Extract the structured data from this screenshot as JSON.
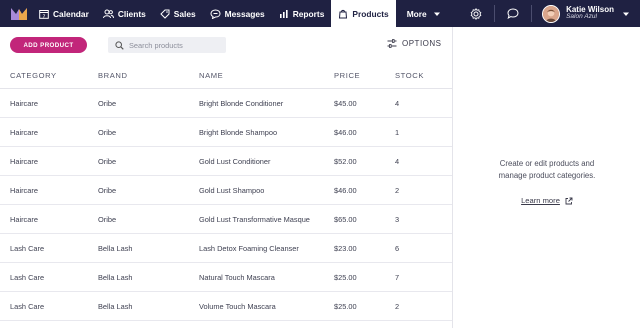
{
  "nav": {
    "items": [
      {
        "label": "Calendar",
        "icon": "calendar-icon"
      },
      {
        "label": "Clients",
        "icon": "clients-icon"
      },
      {
        "label": "Sales",
        "icon": "tag-icon"
      },
      {
        "label": "Messages",
        "icon": "messages-icon"
      },
      {
        "label": "Reports",
        "icon": "reports-icon"
      },
      {
        "label": "Products",
        "icon": "products-icon",
        "active": true
      },
      {
        "label": "More",
        "icon": "chevron-down-icon"
      }
    ],
    "user": {
      "name": "Katie Wilson",
      "salon": "Salon Azul"
    }
  },
  "toolbar": {
    "add_label": "ADD PRODUCT",
    "search_placeholder": "Search products",
    "options_label": "OPTIONS"
  },
  "table": {
    "headers": {
      "category": "CATEGORY",
      "brand": "BRAND",
      "name": "NAME",
      "price": "PRICE",
      "stock": "STOCK"
    },
    "rows": [
      {
        "category": "Haircare",
        "brand": "Oribe",
        "name": "Bright Blonde Conditioner",
        "price": "$45.00",
        "stock": "4"
      },
      {
        "category": "Haircare",
        "brand": "Oribe",
        "name": "Bright Blonde Shampoo",
        "price": "$46.00",
        "stock": "1"
      },
      {
        "category": "Haircare",
        "brand": "Oribe",
        "name": "Gold Lust Conditioner",
        "price": "$52.00",
        "stock": "4"
      },
      {
        "category": "Haircare",
        "brand": "Oribe",
        "name": "Gold Lust Shampoo",
        "price": "$46.00",
        "stock": "2"
      },
      {
        "category": "Haircare",
        "brand": "Oribe",
        "name": "Gold Lust Transformative Masque",
        "price": "$65.00",
        "stock": "3"
      },
      {
        "category": "Lash Care",
        "brand": "Bella Lash",
        "name": "Lash Detox Foaming Cleanser",
        "price": "$23.00",
        "stock": "6"
      },
      {
        "category": "Lash Care",
        "brand": "Bella Lash",
        "name": "Natural Touch Mascara",
        "price": "$25.00",
        "stock": "7"
      },
      {
        "category": "Lash Care",
        "brand": "Bella Lash",
        "name": "Volume Touch Mascara",
        "price": "$25.00",
        "stock": "2"
      }
    ]
  },
  "side": {
    "line1": "Create or edit products and",
    "line2": "manage product categories.",
    "link_label": "Learn more"
  },
  "colors": {
    "nav_bg": "#1f2142",
    "accent": "#c2267a"
  }
}
